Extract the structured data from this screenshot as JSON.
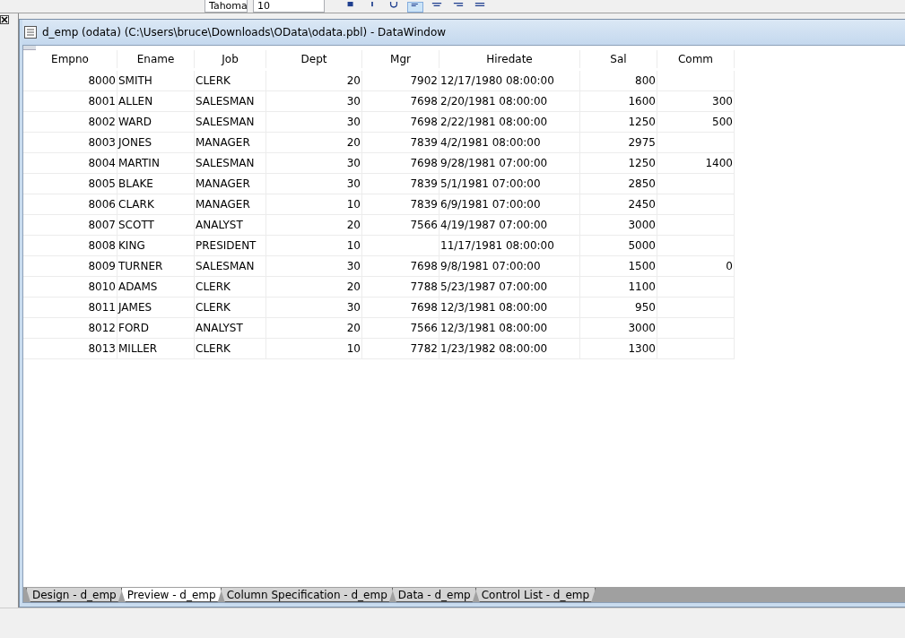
{
  "toolbar": {
    "font_name": "Tahoma",
    "font_size": "10"
  },
  "window": {
    "title": "d_emp  (odata) (C:\\Users\\bruce\\Downloads\\OData\\odata.pbl) - DataWindow"
  },
  "table": {
    "columns": [
      "Empno",
      "Ename",
      "Job",
      "Dept",
      "Mgr",
      "Hiredate",
      "Sal",
      "Comm"
    ],
    "rows": [
      [
        "8000",
        "SMITH",
        "CLERK",
        "20",
        "7902",
        "12/17/1980 08:00:00",
        "800",
        ""
      ],
      [
        "8001",
        "ALLEN",
        "SALESMAN",
        "30",
        "7698",
        "2/20/1981 08:00:00",
        "1600",
        "300"
      ],
      [
        "8002",
        "WARD",
        "SALESMAN",
        "30",
        "7698",
        "2/22/1981 08:00:00",
        "1250",
        "500"
      ],
      [
        "8003",
        "JONES",
        "MANAGER",
        "20",
        "7839",
        "4/2/1981 08:00:00",
        "2975",
        ""
      ],
      [
        "8004",
        "MARTIN",
        "SALESMAN",
        "30",
        "7698",
        "9/28/1981 07:00:00",
        "1250",
        "1400"
      ],
      [
        "8005",
        "BLAKE",
        "MANAGER",
        "30",
        "7839",
        "5/1/1981 07:00:00",
        "2850",
        ""
      ],
      [
        "8006",
        "CLARK",
        "MANAGER",
        "10",
        "7839",
        "6/9/1981 07:00:00",
        "2450",
        ""
      ],
      [
        "8007",
        "SCOTT",
        "ANALYST",
        "20",
        "7566",
        "4/19/1987 07:00:00",
        "3000",
        ""
      ],
      [
        "8008",
        "KING",
        "PRESIDENT",
        "10",
        "",
        "11/17/1981 08:00:00",
        "5000",
        ""
      ],
      [
        "8009",
        "TURNER",
        "SALESMAN",
        "30",
        "7698",
        "9/8/1981 07:00:00",
        "1500",
        "0"
      ],
      [
        "8010",
        "ADAMS",
        "CLERK",
        "20",
        "7788",
        "5/23/1987 07:00:00",
        "1100",
        ""
      ],
      [
        "8011",
        "JAMES",
        "CLERK",
        "30",
        "7698",
        "12/3/1981 08:00:00",
        "950",
        ""
      ],
      [
        "8012",
        "FORD",
        "ANALYST",
        "20",
        "7566",
        "12/3/1981 08:00:00",
        "3000",
        ""
      ],
      [
        "8013",
        "MILLER",
        "CLERK",
        "10",
        "7782",
        "1/23/1982 08:00:00",
        "1300",
        ""
      ]
    ]
  },
  "tabs": [
    {
      "label": "Design - d_emp",
      "selected": false
    },
    {
      "label": "Preview - d_emp",
      "selected": true
    },
    {
      "label": "Column Specification - d_emp",
      "selected": false
    },
    {
      "label": "Data - d_emp",
      "selected": false
    },
    {
      "label": "Control List - d_emp",
      "selected": false
    }
  ]
}
